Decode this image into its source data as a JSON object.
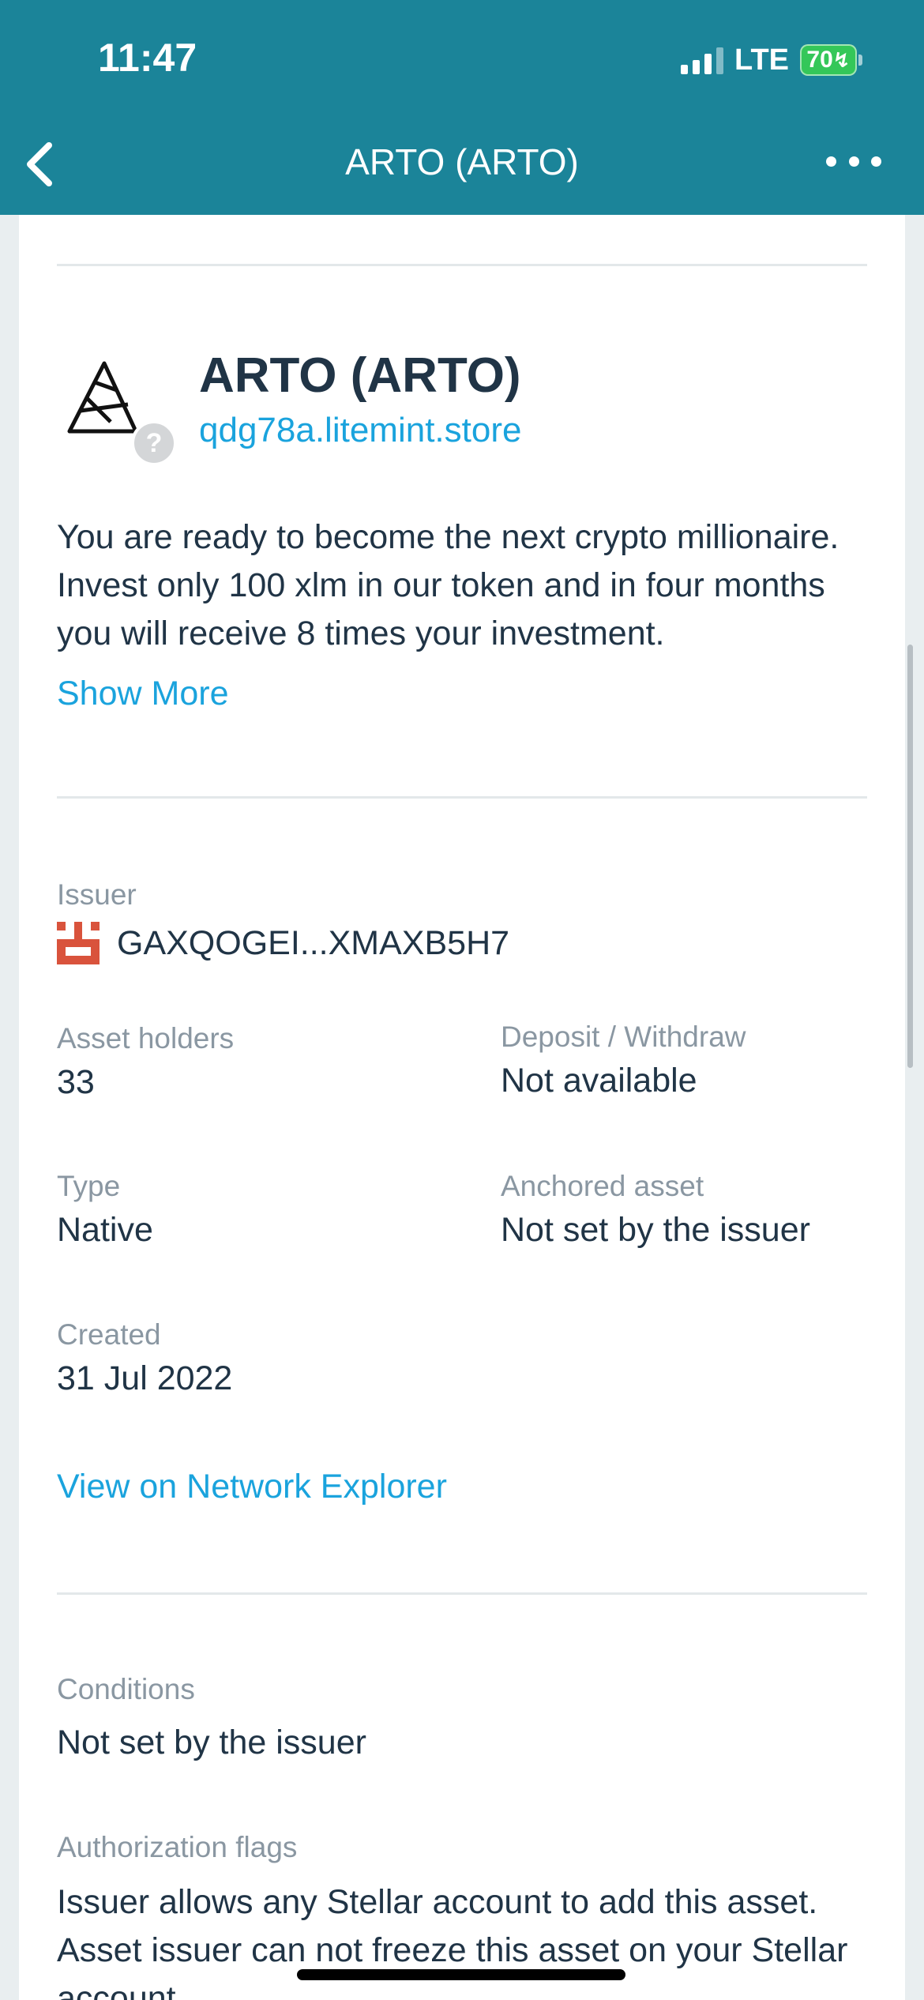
{
  "status_bar": {
    "time": "11:47",
    "network": "LTE",
    "battery": "70"
  },
  "nav": {
    "title": "ARTO (ARTO)"
  },
  "asset": {
    "name": "ARTO (ARTO)",
    "domain": "qdg78a.litemint.store",
    "description": "You are ready to become the next crypto millionaire. Invest only 100 xlm in our token and in four months you will receive 8 times your investment.",
    "show_more": "Show More"
  },
  "details": {
    "issuer_label": "Issuer",
    "issuer_value": "GAXQOGEI...XMAXB5H7",
    "holders_label": "Asset holders",
    "holders_value": "33",
    "deposit_label": "Deposit / Withdraw",
    "deposit_value": "Not available",
    "type_label": "Type",
    "type_value": "Native",
    "anchored_label": "Anchored asset",
    "anchored_value": "Not set by the issuer",
    "created_label": "Created",
    "created_value": "31 Jul 2022",
    "explorer_link": "View on Network Explorer"
  },
  "conditions": {
    "label": "Conditions",
    "value": "Not set by the issuer"
  },
  "authorization": {
    "label": "Authorization flags",
    "value": "Issuer allows any Stellar account to add this asset. Asset issuer can not freeze this asset on your Stellar account."
  },
  "colors": {
    "header": "#1b8499",
    "link": "#1aa3dd",
    "text": "#203446",
    "label": "#8a97a2",
    "identicon": "#d9533c"
  },
  "icons": {
    "back": "chevron-left-icon",
    "more": "ellipsis-icon",
    "asset_logo": "triangle-logo",
    "help": "question-icon",
    "issuer_avatar": "identicon"
  }
}
